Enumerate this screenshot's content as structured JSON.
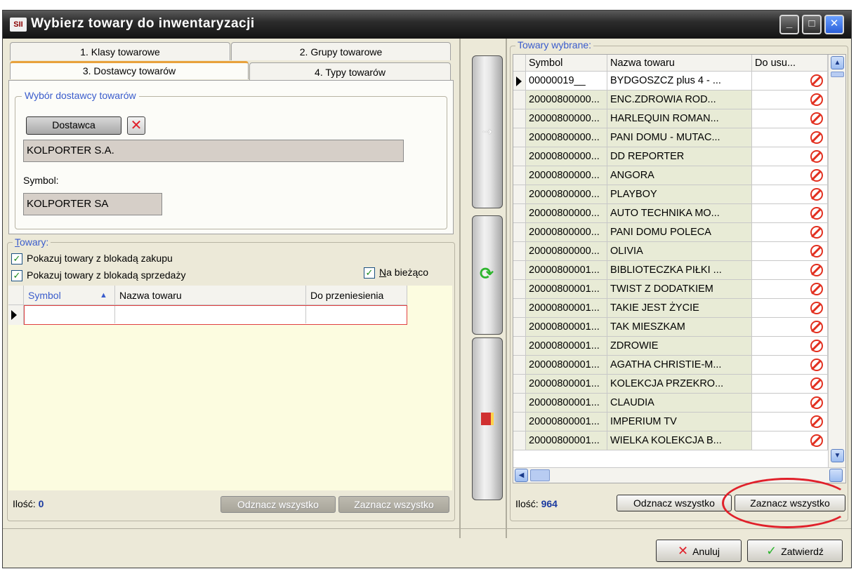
{
  "window": {
    "title": "Wybierz towary do inwentaryzacji"
  },
  "tabs": [
    {
      "label": "1. Klasy towarowe"
    },
    {
      "label": "2. Grupy towarowe"
    },
    {
      "label": "3. Dostawcy towarów"
    },
    {
      "label": "4. Typy towarów"
    }
  ],
  "supplier": {
    "group_title": "Wybór dostawcy towarów",
    "button_label": "Dostawca",
    "name_value": "KOLPORTER S.A.",
    "symbol_label": "Symbol:",
    "symbol_value": "KOLPORTER SA"
  },
  "goods": {
    "group_title": "Towary:",
    "chk_purchase_block": "Pokazuj towary z blokadą zakupu",
    "chk_sale_block": "Pokazuj towary z blokadą sprzedaży",
    "chk_current": "Na bieżąco",
    "columns": [
      "Symbol",
      "Nazwa towaru",
      "Do przeniesienia"
    ],
    "count_label": "Ilość:",
    "count_value": "0",
    "unselect_all": "Odznacz wszystko",
    "select_all": "Zaznacz wszystko"
  },
  "selected": {
    "group_title": "Towary wybrane:",
    "columns": [
      "Symbol",
      "Nazwa towaru",
      "Do usu..."
    ],
    "rows": [
      {
        "symbol": "00000019__",
        "name": "BYDGOSZCZ plus 4 - ..."
      },
      {
        "symbol": "20000800000...",
        "name": "ENC.ZDROWIA ROD..."
      },
      {
        "symbol": "20000800000...",
        "name": "HARLEQUIN ROMAN..."
      },
      {
        "symbol": "20000800000...",
        "name": "PANI DOMU - MUTAC..."
      },
      {
        "symbol": "20000800000...",
        "name": "DD REPORTER"
      },
      {
        "symbol": "20000800000...",
        "name": "ANGORA"
      },
      {
        "symbol": "20000800000...",
        "name": "PLAYBOY"
      },
      {
        "symbol": "20000800000...",
        "name": "AUTO TECHNIKA MO..."
      },
      {
        "symbol": "20000800000...",
        "name": "PANI DOMU POLECA"
      },
      {
        "symbol": "20000800000...",
        "name": "OLIVIA"
      },
      {
        "symbol": "20000800001...",
        "name": "BIBLIOTECZKA PIŁKI ..."
      },
      {
        "symbol": "20000800001...",
        "name": "TWIST Z DODATKIEM"
      },
      {
        "symbol": "20000800001...",
        "name": "TAKIE JEST ŻYCIE"
      },
      {
        "symbol": "20000800001...",
        "name": "TAK MIESZKAM"
      },
      {
        "symbol": "20000800001...",
        "name": "ZDROWIE"
      },
      {
        "symbol": "20000800001...",
        "name": "AGATHA CHRISTIE-M..."
      },
      {
        "symbol": "20000800001...",
        "name": "KOLEKCJA PRZEKRO..."
      },
      {
        "symbol": "20000800001...",
        "name": "CLAUDIA"
      },
      {
        "symbol": "20000800001...",
        "name": "IMPERIUM TV"
      },
      {
        "symbol": "20000800001...",
        "name": "WIELKA KOLEKCJA B..."
      }
    ],
    "count_label": "Ilość:",
    "count_value": "964",
    "unselect_all": "Odznacz wszystko",
    "select_all": "Zaznacz wszystko"
  },
  "footer": {
    "cancel": "Anuluj",
    "confirm": "Zatwierdź"
  },
  "colors": {
    "accent_annotation": "#e0202a",
    "tab_active_accent": "#e8a23c",
    "label_blue": "#3a5ccc"
  }
}
